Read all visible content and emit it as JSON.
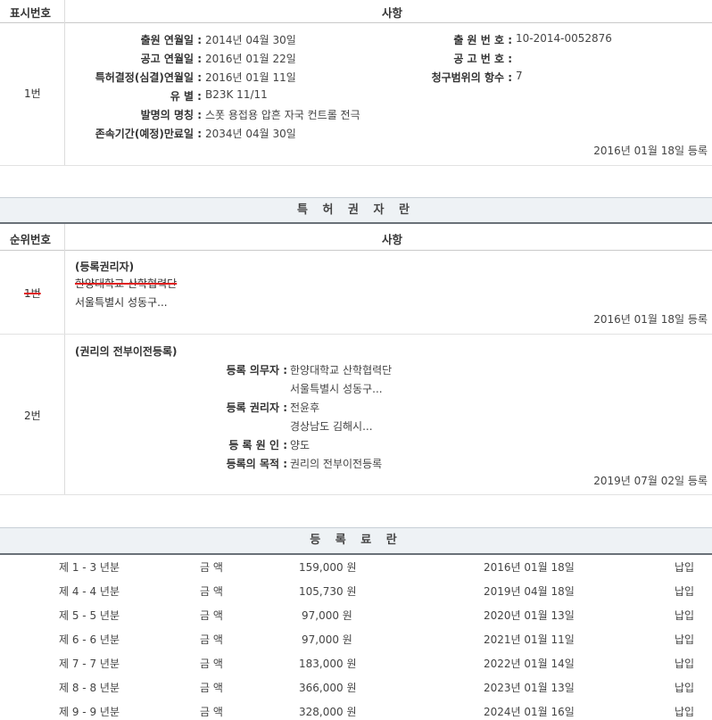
{
  "table1": {
    "col_no": "표시번호",
    "col_item": "사항",
    "row_no": "1번",
    "fields_left": [
      {
        "label": "출원 연월일 :",
        "value": "2014년 04월 30일"
      },
      {
        "label": "공고 연월일 :",
        "value": "2016년 01월 22일"
      },
      {
        "label": "특허결정(심결)연월일 :",
        "value": "2016년 01월 11일"
      },
      {
        "label": "유 별 :",
        "value": "B23K 11/11"
      },
      {
        "label": "발명의 명칭 :",
        "value": "스폿 용접용 압흔 자국 컨트롤 전극"
      },
      {
        "label": "존속기간(예정)만료일 :",
        "value": "2034년 04월 30일"
      }
    ],
    "fields_right": [
      {
        "label": "출 원 번 호 :",
        "value": "10-2014-0052876"
      },
      {
        "label": "공 고 번 호 :",
        "value": ""
      },
      {
        "label": "청구범위의 항수 :",
        "value": "7"
      }
    ],
    "registered": "2016년 01월 18일 등록"
  },
  "owners": {
    "title": "특 허 권 자 란",
    "col_no": "순위번호",
    "col_item": "사항",
    "entry1": {
      "no": "1번",
      "heading": "(등록권리자)",
      "name": "한양대학교 산학협력단",
      "address": "서울특별시 성동구...",
      "registered": "2016년 01월 18일 등록"
    },
    "entry2": {
      "no": "2번",
      "heading": "(권리의 전부이전등록)",
      "fields": [
        {
          "label": "등록 의무자 :",
          "value": "한양대학교 산학협력단"
        },
        {
          "label": "",
          "value": "서울특별시 성동구..."
        },
        {
          "label": "등록 권리자 :",
          "value": "전윤후"
        },
        {
          "label": "",
          "value": "경상남도 김해시..."
        },
        {
          "label": "등 록 원 인 :",
          "value": "양도"
        },
        {
          "label": "등록의 목적 :",
          "value": "권리의 전부이전등록"
        }
      ],
      "registered": "2019년 07월 02일 등록"
    }
  },
  "fees": {
    "title": "등 록 료 란",
    "rows": [
      {
        "period": "제 1 - 3 년분",
        "label": "금 액",
        "amount": "159,000 원",
        "date": "2016년 01월 18일",
        "status": "납입"
      },
      {
        "period": "제 4 - 4 년분",
        "label": "금 액",
        "amount": "105,730 원",
        "date": "2019년 04월 18일",
        "status": "납입"
      },
      {
        "period": "제 5 - 5 년분",
        "label": "금 액",
        "amount": "97,000 원",
        "date": "2020년 01월 13일",
        "status": "납입"
      },
      {
        "period": "제 6 - 6 년분",
        "label": "금 액",
        "amount": "97,000 원",
        "date": "2021년 01월 11일",
        "status": "납입"
      },
      {
        "period": "제 7 - 7 년분",
        "label": "금 액",
        "amount": "183,000 원",
        "date": "2022년 01월 14일",
        "status": "납입"
      },
      {
        "period": "제 8 - 8 년분",
        "label": "금 액",
        "amount": "366,000 원",
        "date": "2023년 01월 13일",
        "status": "납입"
      },
      {
        "period": "제 9 - 9 년분",
        "label": "금 액",
        "amount": "328,000 원",
        "date": "2024년 01월 16일",
        "status": "납입"
      }
    ]
  }
}
